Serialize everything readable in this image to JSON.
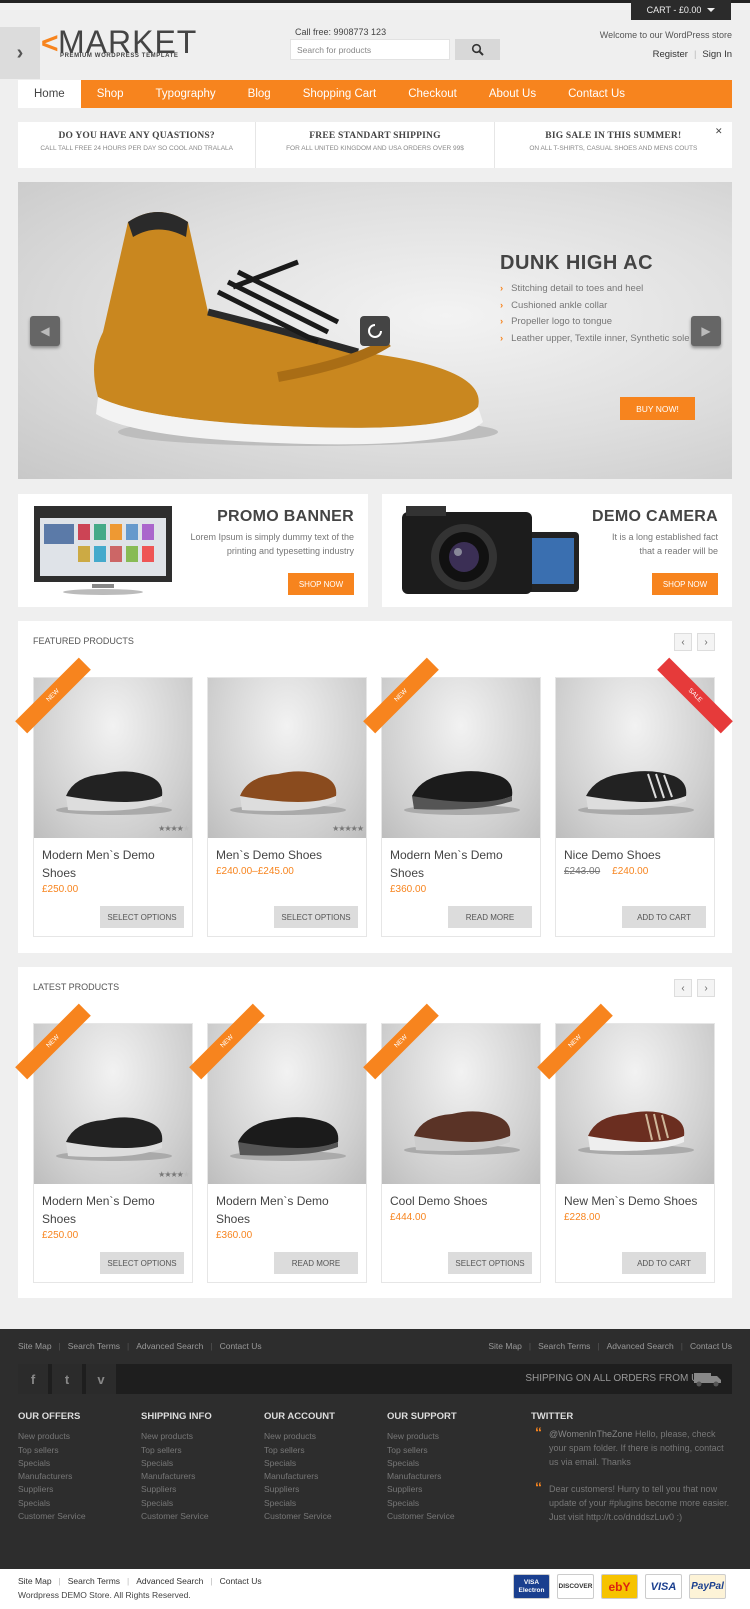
{
  "header": {
    "cart_label": "CART - £0.00",
    "logo_text": "MARKET",
    "logo_tagline": "PREMIUM WORDPRESS TEMPLATE",
    "call_free": "Call free: 9908773 123",
    "search_placeholder": "Search for products",
    "welcome": "Welcome to our WordPress store",
    "register": "Register",
    "sign_in": "Sign In"
  },
  "nav": {
    "items": [
      "Home",
      "Shop",
      "Typography",
      "Blog",
      "Shopping Cart",
      "Checkout",
      "About Us",
      "Contact Us"
    ]
  },
  "infobar": [
    {
      "title": "DO YOU HAVE ANY QUASTIONS?",
      "sub": "CALL TALL FREE 24 HOURS PER DAY SO COOL AND TRALALA"
    },
    {
      "title": "FREE STANDART SHIPPING",
      "sub": "FOR ALL UNITED KINGDOM AND USA ORDERS OVER 99$"
    },
    {
      "title": "BIG SALE IN THIS SUMMER!",
      "sub": "ON ALL T-SHIRTS, CASUAL SHOES AND MENS COUTS"
    }
  ],
  "slider": {
    "title": "DUNK HIGH AC",
    "bullets": [
      "Stitching detail to toes and heel",
      "Cushioned ankle collar",
      "Propeller logo to tongue",
      "Leather upper, Textile inner, Synthetic sole"
    ],
    "button": "BUY NOW!"
  },
  "promos": [
    {
      "title": "PROMO BANNER",
      "desc": "Lorem Ipsum is simply dummy text of the printing and typesetting industry",
      "button": "SHOP NOW"
    },
    {
      "title": "DEMO CAMERA",
      "desc": "It is a long established fact that a reader will be",
      "button": "SHOP NOW"
    }
  ],
  "featured": {
    "title": "FEATURED PRODUCTS",
    "products": [
      {
        "name": "Modern Men`s Demo Shoes",
        "price": "£250.00",
        "old_price": "",
        "button": "SELECT OPTIONS",
        "badge": "NEW",
        "rating": 4
      },
      {
        "name": "Men`s Demo Shoes",
        "price": "£240.00–£245.00",
        "old_price": "",
        "button": "SELECT OPTIONS",
        "badge": "",
        "rating": 5
      },
      {
        "name": "Modern Men`s Demo Shoes",
        "price": "£360.00",
        "old_price": "",
        "button": "READ MORE",
        "badge": "NEW",
        "rating": 0
      },
      {
        "name": "Nice Demo Shoes",
        "price": "£240.00",
        "old_price": "£243.00",
        "button": "ADD TO CART",
        "badge": "SALE",
        "rating": 0
      }
    ]
  },
  "latest": {
    "title": "LATEST PRODUCTS",
    "products": [
      {
        "name": "Modern Men`s Demo Shoes",
        "price": "£250.00",
        "old_price": "",
        "button": "SELECT OPTIONS",
        "badge": "NEW",
        "rating": 4
      },
      {
        "name": "Modern Men`s Demo Shoes",
        "price": "£360.00",
        "old_price": "",
        "button": "READ MORE",
        "badge": "NEW",
        "rating": 0
      },
      {
        "name": "Cool Demo Shoes",
        "price": "£444.00",
        "old_price": "",
        "button": "SELECT OPTIONS",
        "badge": "NEW",
        "rating": 0
      },
      {
        "name": "New Men`s Demo Shoes",
        "price": "£228.00",
        "old_price": "",
        "button": "ADD TO CART",
        "badge": "NEW",
        "rating": 0
      }
    ]
  },
  "footer": {
    "links": [
      "Site Map",
      "Search Terms",
      "Advanced Search",
      "Contact Us"
    ],
    "shipping_text": "SHIPPING ON ALL ORDERS FROM UK",
    "columns": [
      {
        "title": "OUR OFFERS",
        "items": [
          "New products",
          "Top sellers",
          "Specials",
          "Manufacturers",
          "Suppliers",
          "Specials",
          "Customer Service"
        ]
      },
      {
        "title": "SHIPPING INFO",
        "items": [
          "New products",
          "Top sellers",
          "Specials",
          "Manufacturers",
          "Suppliers",
          "Specials",
          "Customer Service"
        ]
      },
      {
        "title": "OUR ACCOUNT",
        "items": [
          "New products",
          "Top sellers",
          "Specials",
          "Manufacturers",
          "Suppliers",
          "Specials",
          "Customer Service"
        ]
      },
      {
        "title": "OUR SUPPORT",
        "items": [
          "New products",
          "Top sellers",
          "Specials",
          "Manufacturers",
          "Suppliers",
          "Specials",
          "Customer Service"
        ]
      }
    ],
    "twitter_title": "TWITTER",
    "tweets": [
      {
        "handle": "@WomenInTheZone",
        "text": " Hello, please, check your spam folder. If there is nothing, contact us via email. Thanks"
      },
      {
        "handle": "",
        "text": "Dear customers! Hurry to tell you that now update of your #plugins become more easier. Just visit http://t.co/dnddszLuv0 :)"
      }
    ],
    "copyright": "Wordpress DEMO Store. All Rights Reserved.",
    "payments": [
      "VISA Electron",
      "DISCOVER",
      "ebY",
      "VISA",
      "PayPal"
    ]
  },
  "colors": {
    "accent": "#f7841e",
    "dark": "#2d2d2d"
  }
}
